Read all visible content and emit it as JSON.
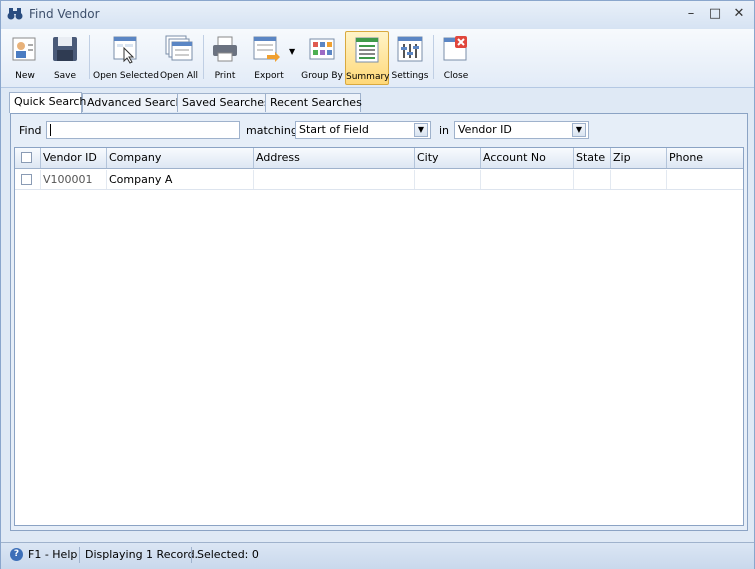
{
  "window": {
    "title": "Find Vendor",
    "controls": {
      "minimize": "–",
      "maximize": "□",
      "close": "✕"
    }
  },
  "toolbar": {
    "new": "New",
    "save": "Save",
    "open_selected": "Open Selected",
    "open_all": "Open All",
    "print": "Print",
    "export": "Export",
    "group_by": "Group By",
    "summary": "Summary",
    "settings": "Settings",
    "close": "Close"
  },
  "tabs": [
    "Quick Search",
    "Advanced Search",
    "Saved Searches",
    "Recent Searches"
  ],
  "search": {
    "find_label": "Find",
    "find_value": "",
    "matching_label": "matching",
    "matching_value": "Start of Field",
    "in_label": "in",
    "in_value": "Vendor ID"
  },
  "grid": {
    "columns": [
      "Vendor ID",
      "Company",
      "Address",
      "City",
      "Account No",
      "State",
      "Zip",
      "Phone"
    ],
    "rows": [
      {
        "vendor_id": "V100001",
        "company": "Company A",
        "address": "",
        "city": "",
        "account_no": "",
        "state": "",
        "zip": "",
        "phone": ""
      }
    ]
  },
  "status": {
    "help": "F1 - Help",
    "records": "Displaying 1 Record.",
    "selected": "Selected: 0"
  },
  "colors": {
    "accent": "#ffd878",
    "border": "#8ba3c4",
    "background": "#dfe9f5"
  }
}
